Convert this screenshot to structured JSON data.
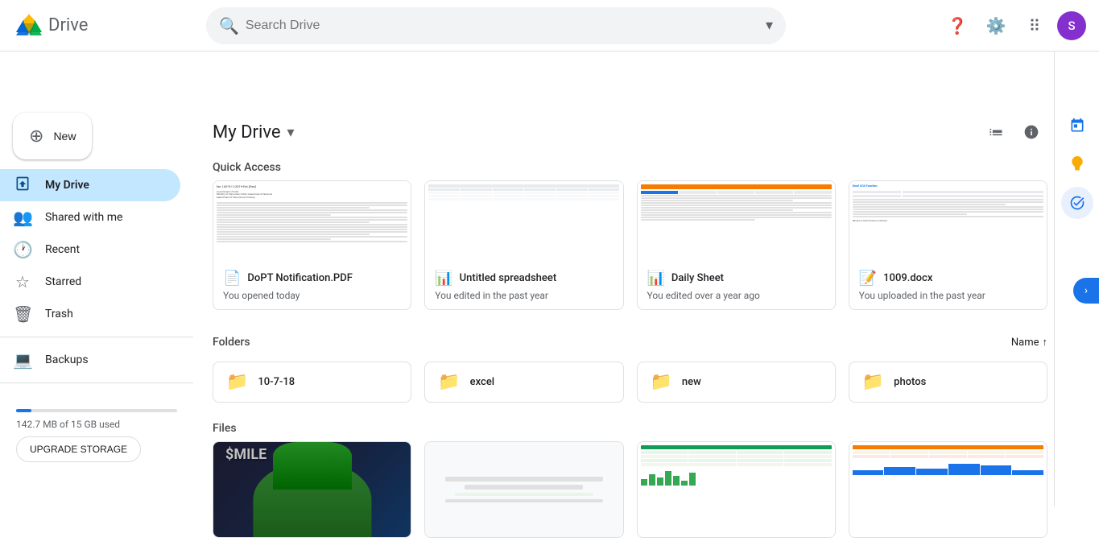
{
  "app": {
    "name": "Drive",
    "logo_letter": "S"
  },
  "search": {
    "placeholder": "Search Drive"
  },
  "sidebar": {
    "new_button": "New",
    "nav_items": [
      {
        "id": "my-drive",
        "label": "My Drive",
        "icon": "📁",
        "active": true
      },
      {
        "id": "shared-with-me",
        "label": "Shared with me",
        "icon": "👥",
        "active": false
      },
      {
        "id": "recent",
        "label": "Recent",
        "icon": "🕐",
        "active": false
      },
      {
        "id": "starred",
        "label": "Starred",
        "icon": "⭐",
        "active": false
      },
      {
        "id": "trash",
        "label": "Trash",
        "icon": "🗑️",
        "active": false
      }
    ],
    "secondary_nav": [
      {
        "id": "backups",
        "label": "Backups",
        "icon": "💻"
      }
    ],
    "storage": {
      "used": "142.7 MB of 15 GB used",
      "upgrade_label": "UPGRADE STORAGE",
      "percent": 9.5
    }
  },
  "main": {
    "title": "My Drive",
    "quick_access_label": "Quick Access",
    "folders_label": "Folders",
    "files_label": "Files",
    "sort_label": "Name",
    "cards": [
      {
        "name": "DoPT Notification.PDF",
        "date": "You opened today",
        "type": "pdf",
        "icon_label": "PDF"
      },
      {
        "name": "Untitled spreadsheet",
        "date": "You edited in the past year",
        "type": "sheets",
        "icon_label": "Sheets"
      },
      {
        "name": "Daily Sheet",
        "date": "You edited over a year ago",
        "type": "sheets",
        "icon_label": "Sheets"
      },
      {
        "name": "1009.docx",
        "date": "You uploaded in the past year",
        "type": "word",
        "icon_label": "Word"
      }
    ],
    "folders": [
      {
        "name": "10-7-18"
      },
      {
        "name": "excel"
      },
      {
        "name": "new"
      },
      {
        "name": "photos"
      }
    ]
  },
  "right_sidebar": {
    "icons": [
      {
        "id": "calendar",
        "label": "Google Calendar",
        "active": false
      },
      {
        "id": "tasks",
        "label": "Google Tasks",
        "active": false
      },
      {
        "id": "todo",
        "label": "To-do",
        "active": true
      }
    ]
  }
}
